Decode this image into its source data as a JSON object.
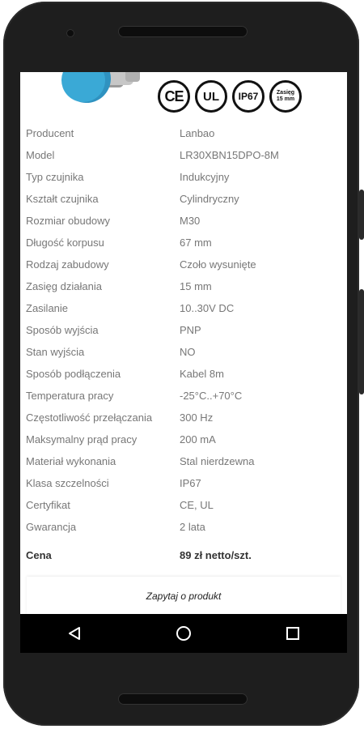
{
  "product": {
    "certifications": [
      {
        "label": "CE"
      },
      {
        "label": "UL"
      },
      {
        "label": "IP67"
      },
      {
        "label_line1": "Zasięg",
        "label_line2": "15 mm"
      }
    ]
  },
  "specs": [
    {
      "label": "Producent",
      "value": "Lanbao"
    },
    {
      "label": "Model",
      "value": "LR30XBN15DPO-8M"
    },
    {
      "label": "Typ czujnika",
      "value": "Indukcyjny"
    },
    {
      "label": "Kształt czujnika",
      "value": "Cylindryczny"
    },
    {
      "label": "Rozmiar obudowy",
      "value": "M30"
    },
    {
      "label": "Długość korpusu",
      "value": "67 mm"
    },
    {
      "label": "Rodzaj zabudowy",
      "value": "Czoło wysunięte"
    },
    {
      "label": "Zasięg działania",
      "value": "15 mm"
    },
    {
      "label": "Zasilanie",
      "value": "10..30V DC"
    },
    {
      "label": "Sposób wyjścia",
      "value": "PNP"
    },
    {
      "label": "Stan wyjścia",
      "value": "NO"
    },
    {
      "label": "Sposób podłączenia",
      "value": "Kabel 8m"
    },
    {
      "label": "Temperatura pracy",
      "value": "-25°C..+70°C"
    },
    {
      "label": "Częstotliwość przełączania",
      "value": "300 Hz"
    },
    {
      "label": "Maksymalny prąd pracy",
      "value": "200 mA"
    },
    {
      "label": "Materiał wykonania",
      "value": "Stal nierdzewna"
    },
    {
      "label": "Klasa szczelności",
      "value": "IP67"
    },
    {
      "label": "Certyfikat",
      "value": "CE, UL"
    },
    {
      "label": "Gwarancja",
      "value": "2 lata"
    }
  ],
  "price": {
    "label": "Cena",
    "value": "89 zł netto/szt."
  },
  "ask_button": {
    "label": "Zapytaj o produkt"
  },
  "navbar": {
    "back_icon": "back-triangle-icon",
    "home_icon": "home-circle-icon",
    "recents_icon": "recents-square-icon"
  },
  "colors": {
    "sensor_cap": "#3aa9d6",
    "phone_body": "#1e1e1e",
    "label_text": "#777777"
  }
}
